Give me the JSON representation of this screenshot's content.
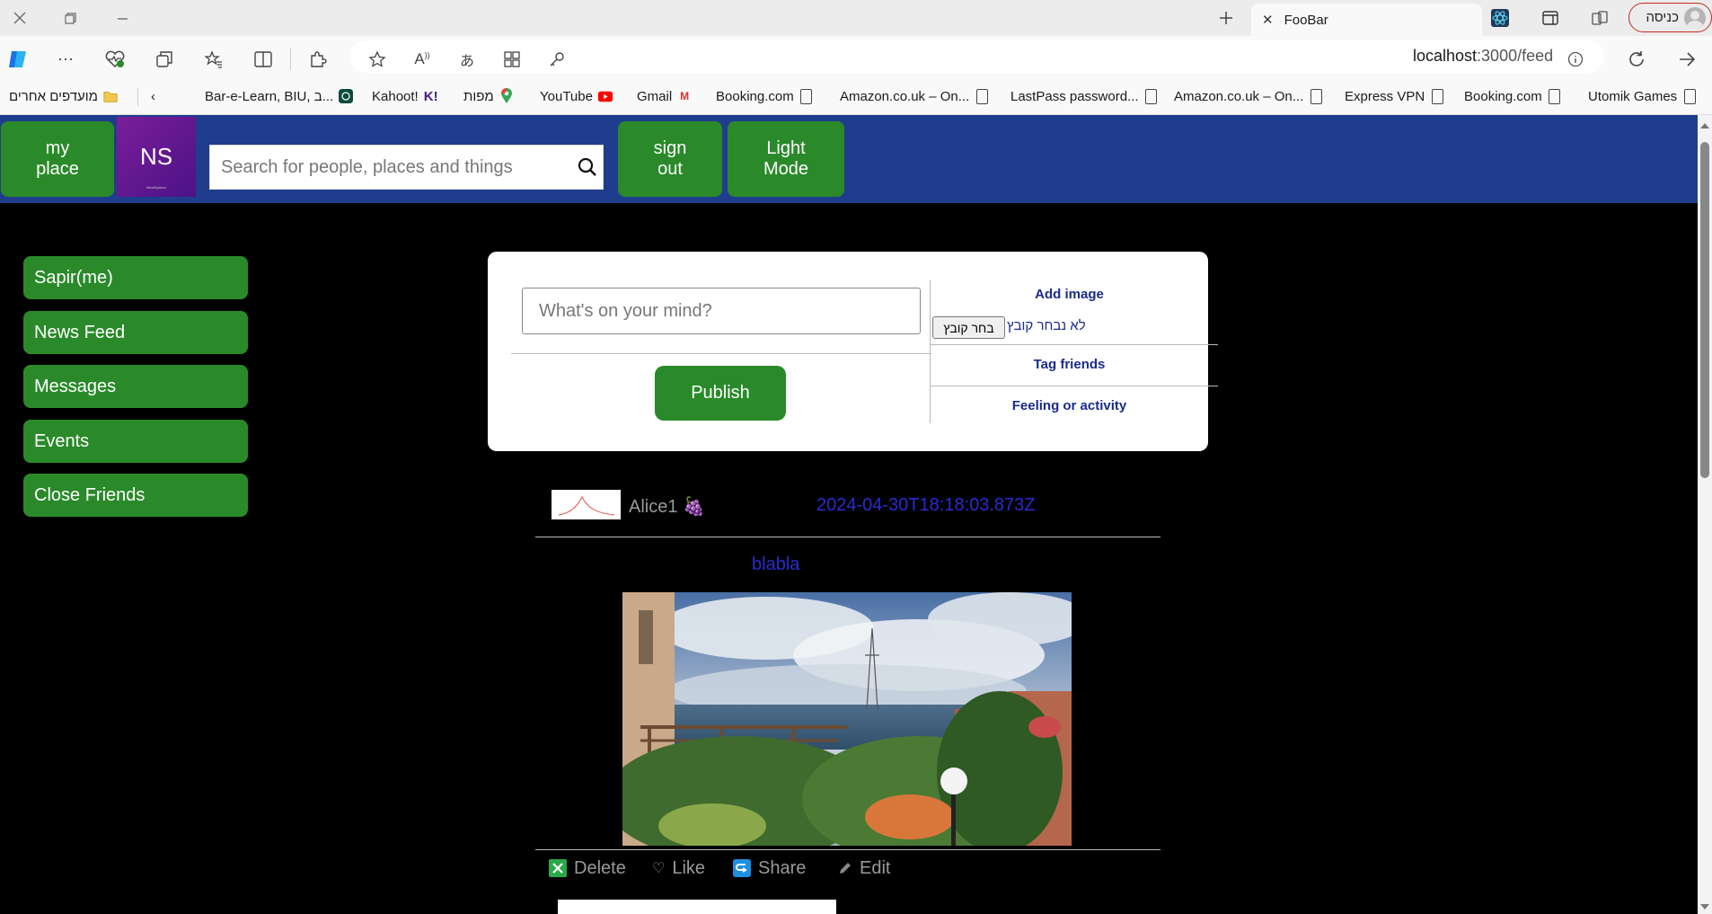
{
  "browser": {
    "tab_title": "FooBar",
    "profile_label": "כניסה",
    "url_host": "localhost",
    "url_path": ":3000/feed",
    "favorites": [
      {
        "label": "Utomik Games",
        "icon": "doc-icon"
      },
      {
        "label": "Booking.com",
        "icon": "doc-icon"
      },
      {
        "label": "Express VPN",
        "icon": "doc-icon"
      },
      {
        "label": "Amazon.co.uk – On...",
        "icon": "doc-icon"
      },
      {
        "label": "LastPass password...",
        "icon": "doc-icon"
      },
      {
        "label": "Amazon.co.uk – On...",
        "icon": "doc-icon"
      },
      {
        "label": "Booking.com",
        "icon": "doc-icon"
      },
      {
        "label": "Gmail",
        "icon": "gmail-icon"
      },
      {
        "label": "YouTube",
        "icon": "youtube-icon"
      },
      {
        "label": "מפות",
        "icon": "maps-icon"
      },
      {
        "label": "Kahoot!",
        "icon": "kahoot-icon"
      },
      {
        "label": "Bar-e-Learn, BIU, ב...",
        "icon": "biu-icon"
      },
      {
        "label": "מועדפים אחרים",
        "icon": "folder-icon"
      }
    ]
  },
  "header": {
    "my_place": "my place",
    "logo_text": "NS",
    "logo_caption": "MeetSphere",
    "search_placeholder": "Search for people, places and things",
    "sign_out": "sign out",
    "light_mode": "Light Mode"
  },
  "sidebar": {
    "items": [
      {
        "label": "Sapir(me)"
      },
      {
        "label": "News Feed"
      },
      {
        "label": "Messages"
      },
      {
        "label": "Events"
      },
      {
        "label": "Close Friends"
      }
    ]
  },
  "composer": {
    "placeholder": "What's on your mind?",
    "publish": "Publish",
    "add_image": "Add image",
    "choose_file": "בחר קובץ",
    "no_file": "לא נבחר קובץ",
    "tag_friends": "Tag friends",
    "feeling": "Feeling or activity"
  },
  "post": {
    "author": "Alice1 🍇",
    "timestamp": "2024-04-30T18:18:03.873Z",
    "text": "blabla",
    "actions": {
      "delete": "Delete",
      "like": "Like",
      "share": "Share",
      "edit": "Edit"
    }
  },
  "colors": {
    "header_bg": "#1f3d8c",
    "button_green": "#2a8a2a",
    "link_blue": "#2b2bd0",
    "profile_border": "#c42b1c"
  }
}
